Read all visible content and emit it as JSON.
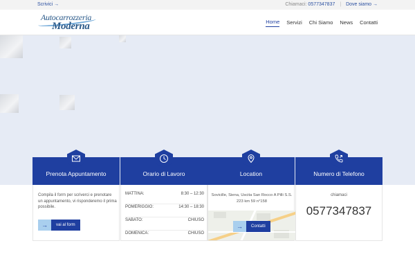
{
  "topbar": {
    "scrivi": "Scrivici →",
    "chiamaci_label": "Chiamaci:",
    "chiamaci_number": "0577347837",
    "separator": "|",
    "dove": "Dove siamo →"
  },
  "logo": {
    "line1": "Autocarrozzeria",
    "line2": "Moderna"
  },
  "nav": {
    "items": [
      {
        "label": "Home",
        "active": true
      },
      {
        "label": "Servizi"
      },
      {
        "label": "Chi Siamo"
      },
      {
        "label": "News"
      },
      {
        "label": "Contatti"
      }
    ]
  },
  "panels": {
    "prenota": {
      "title": "Prenota Appuntamento",
      "icon": "envelope-icon",
      "description": "Compila il form per scriverci e prenotare un appuntamento, vi risponderemo il prima possibile.",
      "button_arrow": "→",
      "button_label": "vai al form"
    },
    "orario": {
      "title": "Orario di Lavoro",
      "icon": "clock-icon",
      "rows": [
        {
          "day": "MATTINA:",
          "time": "8:30 – 12:30"
        },
        {
          "day": "POMERIGGIO:",
          "time": "14:30 – 18:30"
        },
        {
          "day": "SABATO:",
          "time": "CHIUSO"
        },
        {
          "day": "DOMENICA:",
          "time": "CHIUSO"
        }
      ]
    },
    "location": {
      "title": "Location",
      "icon": "map-pin-icon",
      "address": "Sovicille, Siena, Uscita San Rocco A Pilli S.S. 223 km 59 n°158",
      "button_arrow": "→",
      "button_label": "Contatti"
    },
    "telefono": {
      "title": "Numero di Telefono",
      "icon": "phone-icon",
      "label": "chiamaci",
      "number": "0577347837"
    }
  },
  "colors": {
    "primary": "#1f3fa0",
    "accent_light": "#a9cfee",
    "hero_bg": "#e6ebf5"
  }
}
